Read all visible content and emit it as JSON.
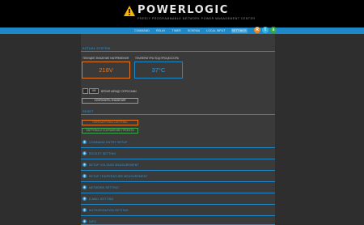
{
  "header": {
    "logo_text": "POWERLOGIC",
    "logo_subtitle": "FREELY PROGRAMMABLE NETWORK POWER MANAGEMENT CENTER"
  },
  "nav": {
    "items": [
      {
        "label": "COMMAND"
      },
      {
        "label": "RELAY"
      },
      {
        "label": "TIMER"
      },
      {
        "label": "SCHEMA"
      },
      {
        "label": "LOCAL INPUT"
      },
      {
        "label": "SETTINGS",
        "active": true
      }
    ]
  },
  "social": [
    {
      "icon": "rss-icon",
      "glyph": "R",
      "color": "#f08a24"
    },
    {
      "icon": "twitter-icon",
      "glyph": "t",
      "color": "#33b5e5"
    },
    {
      "icon": "share-icon",
      "glyph": "s",
      "color": "#3aa84a"
    }
  ],
  "system_section": {
    "title": "ACTUAL SYSTEM",
    "voltage_label": "ТЕКУЩЕЕ ЗНАЧЕНИЕ НАПРЯЖЕНИЯ",
    "voltage_value": "218V",
    "temp_label": "ТЕМПЕРАТУРА ПОД ПРОЦЕССОРА",
    "temp_value": "37°C",
    "interval_value": "180",
    "interval_label": "ВРЕМЯ МЕЖДУ ОПРОСАМИ",
    "save_button": "СОХРАНИТЬ ЗНАЧЕНИЯ"
  },
  "reset_section": {
    "title": "RESET",
    "reboot_button": "ПЕРЕЗАГРУЗКА СИСТЕМЫ",
    "restore_button": "ЗАГРУЗКА И СОХРАНЕНИЕ ПРОЕКТА"
  },
  "accordion": [
    {
      "label": "COMMAND ENTRY SETUP"
    },
    {
      "label": "SOCKET SETTING"
    },
    {
      "label": "SETUP VOLTAGE MEASUREMENT"
    },
    {
      "label": "SETUP TEMPERATURE MEASUREMENT"
    },
    {
      "label": "NETWORK SETTING"
    },
    {
      "label": "E-MAIL SETTING"
    },
    {
      "label": "AUTHORIZATION SETTING"
    },
    {
      "label": "INFO"
    }
  ],
  "colors": {
    "accent": "#1e88c8",
    "warning": "#e8751a",
    "success": "#3aa84a"
  }
}
